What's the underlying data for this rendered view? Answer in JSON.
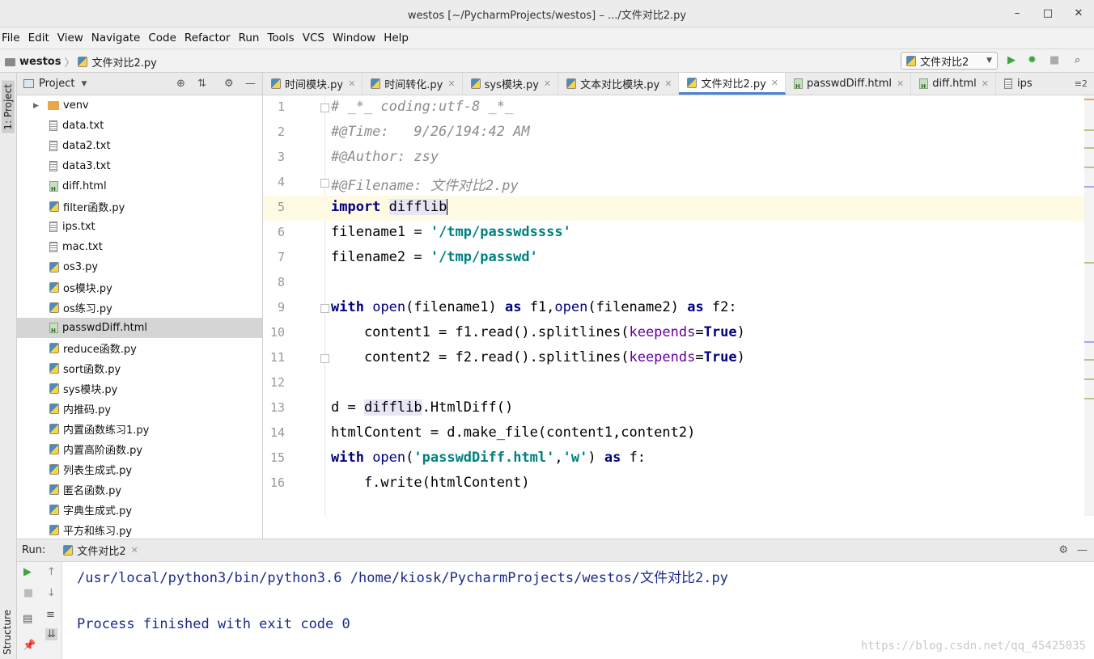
{
  "window": {
    "title": "westos [~/PycharmProjects/westos] – .../文件对比2.py",
    "buttons": {
      "minimize": "–",
      "maximize": "□",
      "close": "✕"
    }
  },
  "menu": [
    "File",
    "Edit",
    "View",
    "Navigate",
    "Code",
    "Refactor",
    "Run",
    "Tools",
    "VCS",
    "Window",
    "Help"
  ],
  "breadcrumb": {
    "project": "westos",
    "file": "文件对比2.py"
  },
  "run_config": {
    "name": "文件对比2"
  },
  "side_tabs": {
    "project": "1: Project",
    "structure": "Structure"
  },
  "project_panel": {
    "title": "Project",
    "items": [
      {
        "name": "venv",
        "type": "dir"
      },
      {
        "name": "data.txt",
        "type": "txt"
      },
      {
        "name": "data2.txt",
        "type": "txt"
      },
      {
        "name": "data3.txt",
        "type": "txt"
      },
      {
        "name": "diff.html",
        "type": "html"
      },
      {
        "name": "filter函数.py",
        "type": "py"
      },
      {
        "name": "ips.txt",
        "type": "txt"
      },
      {
        "name": "mac.txt",
        "type": "txt"
      },
      {
        "name": "os3.py",
        "type": "py"
      },
      {
        "name": "os模块.py",
        "type": "py"
      },
      {
        "name": "os练习.py",
        "type": "py"
      },
      {
        "name": "passwdDiff.html",
        "type": "html",
        "selected": true
      },
      {
        "name": "reduce函数.py",
        "type": "py"
      },
      {
        "name": "sort函数.py",
        "type": "py"
      },
      {
        "name": "sys模块.py",
        "type": "py"
      },
      {
        "name": "内推码.py",
        "type": "py"
      },
      {
        "name": "内置函数练习1.py",
        "type": "py"
      },
      {
        "name": "内置高阶函数.py",
        "type": "py"
      },
      {
        "name": "列表生成式.py",
        "type": "py"
      },
      {
        "name": "匿名函数.py",
        "type": "py"
      },
      {
        "name": "字典生成式.py",
        "type": "py"
      },
      {
        "name": "平方和练习.py",
        "type": "py"
      }
    ]
  },
  "editor_tabs": [
    {
      "label": "时间模块.py",
      "type": "py"
    },
    {
      "label": "时间转化.py",
      "type": "py"
    },
    {
      "label": "sys模块.py",
      "type": "py"
    },
    {
      "label": "文本对比模块.py",
      "type": "py"
    },
    {
      "label": "文件对比2.py",
      "type": "py",
      "active": true
    },
    {
      "label": "passwdDiff.html",
      "type": "html"
    },
    {
      "label": "diff.html",
      "type": "html"
    },
    {
      "label": "ips",
      "type": "txt"
    }
  ],
  "tab_overflow": "≡2",
  "code_lines": [
    "1",
    "2",
    "3",
    "4",
    "5",
    "6",
    "7",
    "8",
    "9",
    "10",
    "11",
    "12",
    "13",
    "14",
    "15",
    "16"
  ],
  "code": {
    "l1": "# _*_ coding:utf-8 _*_",
    "l2": "#@Time:   9/26/194:42 AM",
    "l3": "#@Author: zsy",
    "l4": "#@Filename: 文件对比2.py",
    "l5_kw": "import",
    "l5_mod": "difflib",
    "l6_var": "filename1 = ",
    "l6_str": "'/tmp/passwdssss'",
    "l7_var": "filename2 = ",
    "l7_str": "'/tmp/passwd'",
    "l9_with": "with",
    "l9_open1": "open",
    "l9_a": "(filename1) ",
    "l9_as": "as",
    "l9_b": " f1,",
    "l9_open2": "open",
    "l9_c": "(filename2) ",
    "l9_as2": "as",
    "l9_d": " f2:",
    "l10_a": "    content1 = f1.read().splitlines(",
    "l10_kwarg": "keepends",
    "l10_eq": "=",
    "l10_true": "True",
    "l10_close": ")",
    "l11_a": "    content2 = f2.read().splitlines(",
    "l11_kwarg": "keepends",
    "l11_eq": "=",
    "l11_true": "True",
    "l11_close": ")",
    "l13_a": "d = ",
    "l13_mod": "difflib",
    "l13_b": ".HtmlDiff()",
    "l14": "htmlContent = d.make_file(content1,content2)",
    "l15_with": "with",
    "l15_open": " open",
    "l15_p": "(",
    "l15_s1": "'passwdDiff.html'",
    "l15_comma": ",",
    "l15_s2": "'w'",
    "l15_close": ") ",
    "l15_as": "as",
    "l15_f": " f:",
    "l16": "    f.write(htmlContent)"
  },
  "run_panel": {
    "label": "Run:",
    "tab": "文件对比2",
    "output": [
      "/usr/local/python3/bin/python3.6 /home/kiosk/PycharmProjects/westos/文件对比2.py",
      "",
      "Process finished with exit code 0"
    ]
  },
  "watermark": "https://blog.csdn.net/qq_45425035"
}
